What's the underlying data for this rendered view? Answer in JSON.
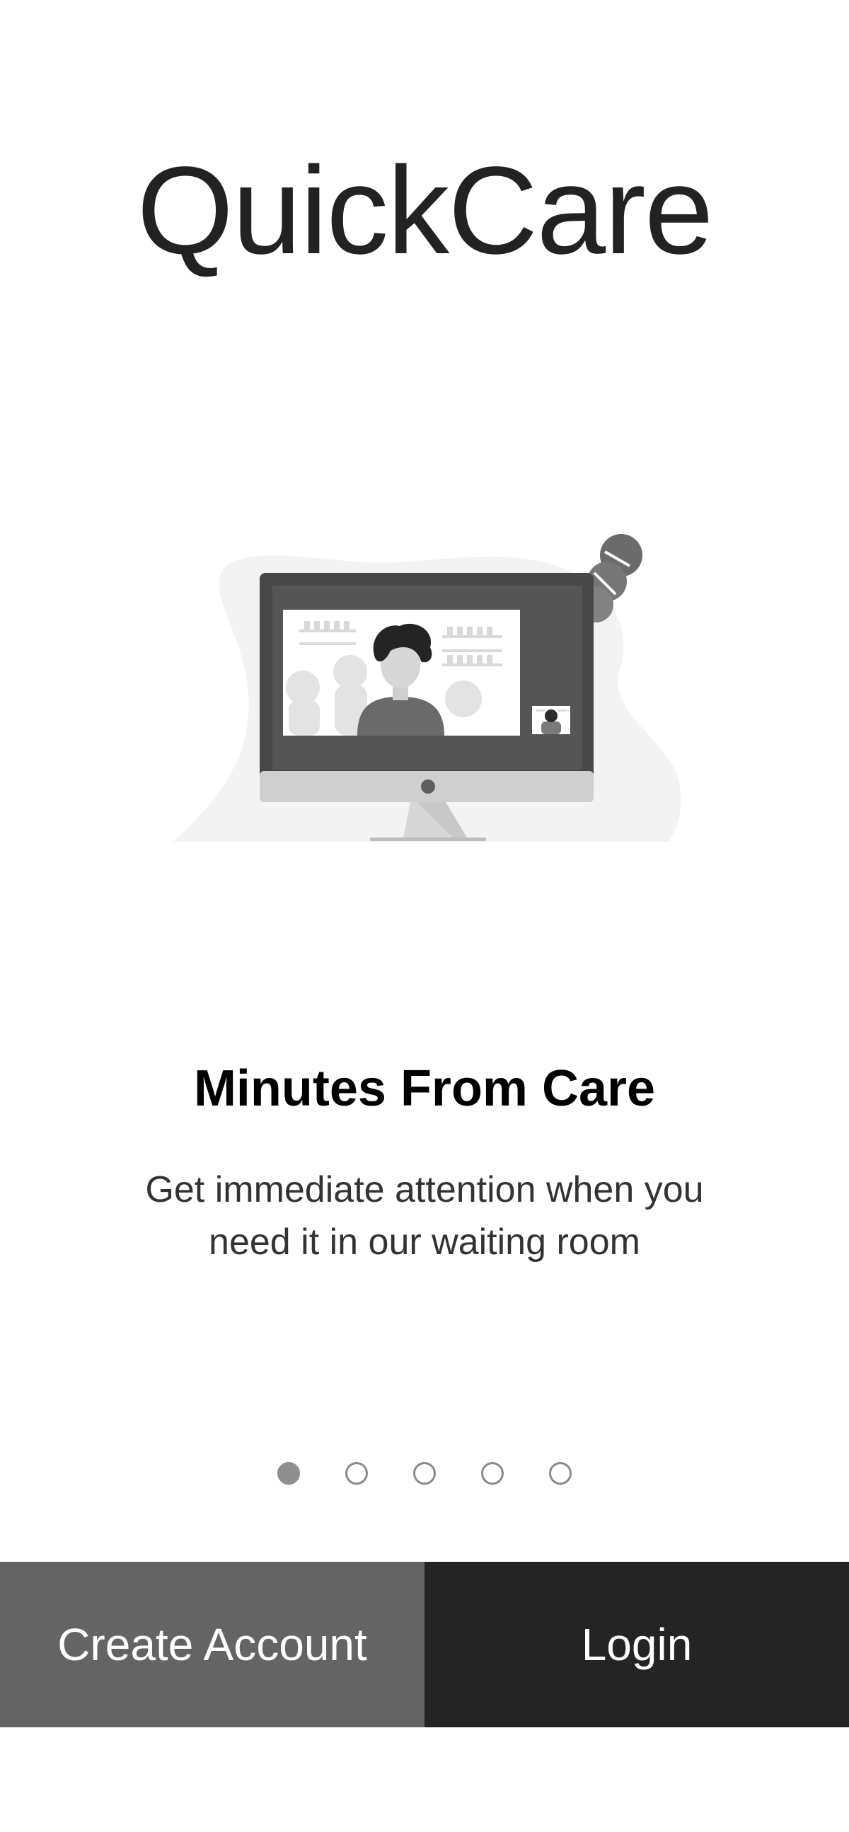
{
  "app": {
    "title": "QuickCare"
  },
  "slide": {
    "illustration": "telehealth-video-call-illustration",
    "title": "Minutes From Care",
    "body": "Get immediate attention when you need it in our waiting room"
  },
  "pager": {
    "count": 5,
    "active_index": 0
  },
  "actions": {
    "create_account_label": "Create Account",
    "login_label": "Login"
  },
  "colors": {
    "create_button_bg": "#646464",
    "login_button_bg": "#242424",
    "dot_active": "#8e8e8e",
    "dot_inactive_border": "#8a8a8a"
  }
}
